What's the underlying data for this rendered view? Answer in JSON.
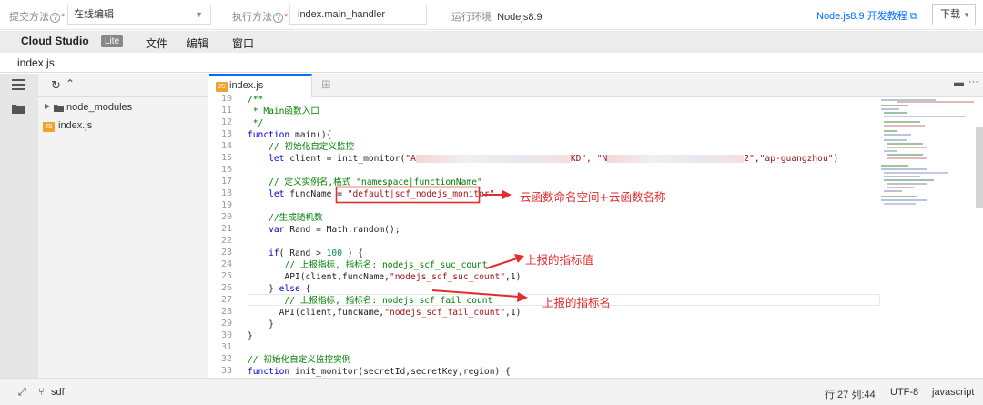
{
  "toolbar": {
    "submit_label": "提交方法",
    "submit_value": "在线编辑",
    "exec_label": "执行方法",
    "exec_value": "index.main_handler",
    "runtime_label": "运行环境",
    "runtime_value": "Nodejs8.9",
    "tutorial_link": "Node.js8.9 开发教程",
    "download_label": "下载"
  },
  "menu": {
    "brand": "Cloud Studio",
    "lite": "Lite",
    "items": [
      "文件",
      "编辑",
      "窗口"
    ]
  },
  "file_bar": {
    "name": "index.js"
  },
  "tree": {
    "folder": "node_modules",
    "file": "index.js"
  },
  "tab": {
    "label": "index.js",
    "icon_text": "JS"
  },
  "code": {
    "line_numbers": [
      "10",
      "11",
      "12",
      "13",
      "14",
      "15",
      "16",
      "17",
      "18",
      "19",
      "20",
      "21",
      "22",
      "23",
      "24",
      "25",
      "26",
      "27",
      "28",
      "29",
      "30",
      "31",
      "32",
      "33"
    ]
  },
  "annotations": {
    "namespace": "云函数命名空间+云函数名称",
    "metric_value": "上报的指标值",
    "metric_name": "上报的指标名"
  },
  "status": {
    "branch": "sdf",
    "position": "行:27 列:44",
    "encoding": "UTF-8",
    "language": "javascript"
  },
  "colors": {
    "accent": "#006eff",
    "annotation": "#e32d2d",
    "badge": "#f0a22b"
  }
}
